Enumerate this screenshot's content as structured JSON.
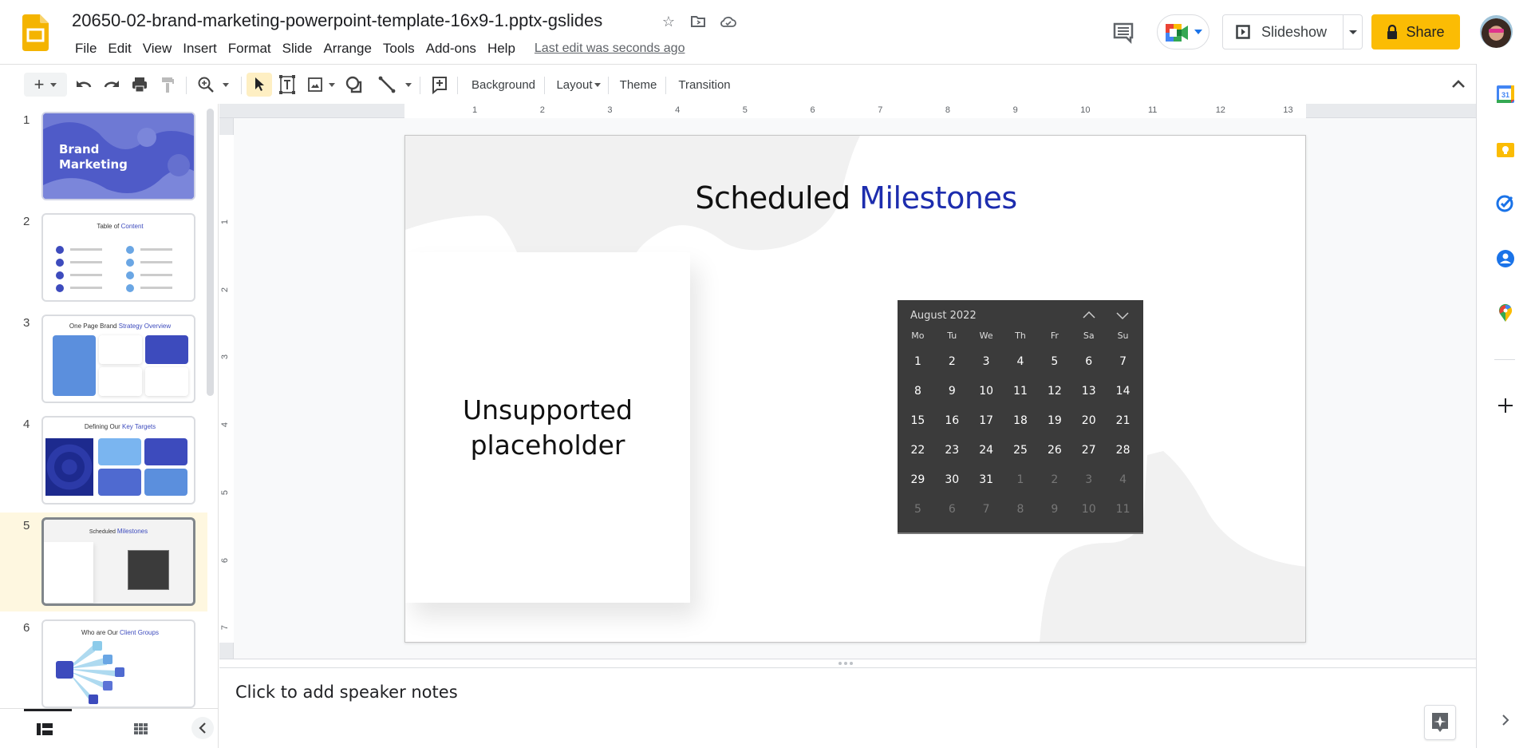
{
  "app": {
    "name": "Google Slides",
    "doc_title": "20650-02-brand-marketing-powerpoint-template-16x9-1.pptx-gslides",
    "last_edit": "Last edit was seconds ago"
  },
  "menu": [
    "File",
    "Edit",
    "View",
    "Insert",
    "Format",
    "Slide",
    "Arrange",
    "Tools",
    "Add-ons",
    "Help"
  ],
  "header_buttons": {
    "slideshow": "Slideshow",
    "share": "Share"
  },
  "toolbar": {
    "background": "Background",
    "layout": "Layout",
    "theme": "Theme",
    "transition": "Transition"
  },
  "ruler": {
    "horizontal": [
      "1",
      "2",
      "3",
      "4",
      "5",
      "6",
      "7",
      "8",
      "9",
      "10",
      "11",
      "12",
      "13"
    ],
    "vertical": [
      "1",
      "2",
      "3",
      "4",
      "5",
      "6",
      "7"
    ]
  },
  "filmstrip": {
    "selected_index": 5,
    "slides": [
      {
        "num": "1",
        "title": "Brand Marketing",
        "accent": ""
      },
      {
        "num": "2",
        "title": "Table of ",
        "accent": "Content"
      },
      {
        "num": "3",
        "title": "One Page Brand ",
        "accent": "Strategy Overview"
      },
      {
        "num": "4",
        "title": "Defining Our ",
        "accent": "Key Targets"
      },
      {
        "num": "5",
        "title": "Scheduled ",
        "accent": "Milestones"
      },
      {
        "num": "6",
        "title": "Who are Our ",
        "accent": "Client Groups"
      }
    ]
  },
  "slide": {
    "title_main": "Scheduled",
    "title_accent": "Milestones",
    "placeholder_line1": "Unsupported",
    "placeholder_line2": "placeholder",
    "calendar": {
      "month_label": "August 2022",
      "weekdays": [
        "Mo",
        "Tu",
        "We",
        "Th",
        "Fr",
        "Sa",
        "Su"
      ],
      "weeks": [
        [
          {
            "d": "1"
          },
          {
            "d": "2"
          },
          {
            "d": "3"
          },
          {
            "d": "4"
          },
          {
            "d": "5"
          },
          {
            "d": "6"
          },
          {
            "d": "7"
          }
        ],
        [
          {
            "d": "8"
          },
          {
            "d": "9"
          },
          {
            "d": "10"
          },
          {
            "d": "11"
          },
          {
            "d": "12"
          },
          {
            "d": "13"
          },
          {
            "d": "14"
          }
        ],
        [
          {
            "d": "15"
          },
          {
            "d": "16"
          },
          {
            "d": "17"
          },
          {
            "d": "18"
          },
          {
            "d": "19"
          },
          {
            "d": "20"
          },
          {
            "d": "21"
          }
        ],
        [
          {
            "d": "22"
          },
          {
            "d": "23"
          },
          {
            "d": "24"
          },
          {
            "d": "25"
          },
          {
            "d": "26"
          },
          {
            "d": "27"
          },
          {
            "d": "28"
          }
        ],
        [
          {
            "d": "29"
          },
          {
            "d": "30"
          },
          {
            "d": "31"
          },
          {
            "d": "1",
            "muted": true
          },
          {
            "d": "2",
            "muted": true
          },
          {
            "d": "3",
            "muted": true
          },
          {
            "d": "4",
            "muted": true
          }
        ],
        [
          {
            "d": "5",
            "muted": true
          },
          {
            "d": "6",
            "muted": true
          },
          {
            "d": "7",
            "muted": true
          },
          {
            "d": "8",
            "muted": true
          },
          {
            "d": "9",
            "muted": true
          },
          {
            "d": "10",
            "muted": true
          },
          {
            "d": "11",
            "muted": true
          }
        ]
      ]
    }
  },
  "notes": {
    "placeholder": "Click to add speaker notes"
  },
  "colors": {
    "accent_blue": "#1d2dae",
    "share_yellow": "#fbbc04",
    "selected_row": "#fef7e0",
    "calendar_bg": "#3b3b3b"
  },
  "side_panel": [
    "calendar-app",
    "keep-app",
    "tasks-app",
    "contacts-app",
    "maps-app",
    "add-addon"
  ]
}
